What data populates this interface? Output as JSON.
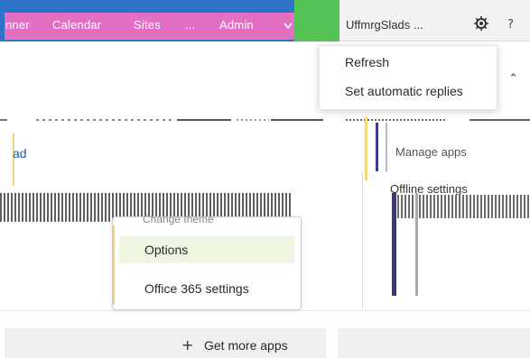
{
  "header": {
    "nav_items": [
      "nner",
      "Calendar",
      "Sites",
      "...",
      "Admin"
    ],
    "user_name": "UffmrgSlads ..."
  },
  "top_menu": {
    "items": [
      "Refresh",
      "Set automatic replies"
    ]
  },
  "left_panel": {
    "link_text": "ad"
  },
  "right_panel": {
    "manage_apps": "Manage apps",
    "offline_settings": "Offline settings"
  },
  "center_menu": {
    "faded_item": "Change theme",
    "items": [
      "Options",
      "Office 365 settings"
    ]
  },
  "footer": {
    "get_more_apps": "Get more apps"
  },
  "icons": {
    "gear": "gear-icon",
    "help": "help-icon",
    "collapse": "chevron-up-double-icon",
    "plus": "plus-icon"
  },
  "colors": {
    "nav_blue": "#2d74c8",
    "nav_pink": "#e26fc2",
    "nav_green": "#53c356",
    "link_blue": "#1b5ea8",
    "highlight": "#eef6e2"
  }
}
